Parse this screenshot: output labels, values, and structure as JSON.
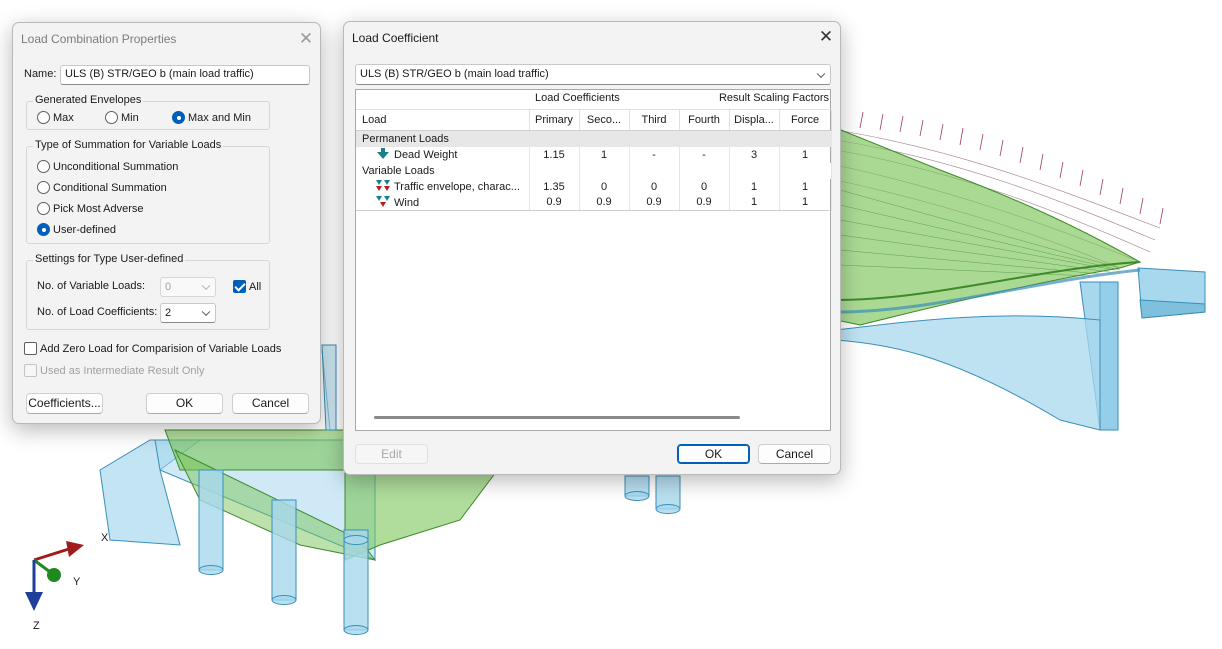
{
  "scene": {
    "axis": {
      "x": "X",
      "y": "Y",
      "z": "Z"
    },
    "colors": {
      "deck": "#7cc45a",
      "deck_edge": "#3e8a2a",
      "pier": "#a8d8ee",
      "pier_edge": "#3a8fb7",
      "axis_x": "#a01c1c",
      "axis_y": "#1f8a1f",
      "axis_z": "#1f3f9a"
    }
  },
  "lcp": {
    "title": "Load Combination Properties",
    "name_label": "Name:",
    "name_value": "ULS (B) STR/GEO b (main load traffic)",
    "envelopes": {
      "title": "Generated Envelopes",
      "options": [
        "Max",
        "Min",
        "Max and Min"
      ],
      "selected": "Max and Min"
    },
    "summation": {
      "title": "Type of Summation for Variable Loads",
      "options": [
        "Unconditional Summation",
        "Conditional Summation",
        "Pick Most Adverse",
        "User-defined"
      ],
      "selected": "User-defined"
    },
    "settings": {
      "title": "Settings for Type User-defined",
      "var_loads_label": "No. of Variable Loads:",
      "var_loads_value": "0",
      "all_label": "All",
      "all_checked": true,
      "coef_label": "No. of Load Coefficients:",
      "coef_value": "2"
    },
    "zero_load_label": "Add Zero Load for Comparision of Variable Loads",
    "intermediate_label": "Used as Intermediate Result Only",
    "buttons": {
      "coefficients": "Coefficients...",
      "ok": "OK",
      "cancel": "Cancel"
    }
  },
  "lc": {
    "title": "Load Coefficient",
    "combo_value": "ULS (B) STR/GEO b (main load traffic)",
    "caption_coefficients": "Load Coefficients",
    "caption_scaling": "Result Scaling Factors",
    "columns": [
      "Load",
      "Primary",
      "Seco...",
      "Third",
      "Fourth",
      "Displa...",
      "Force"
    ],
    "groups": [
      {
        "name": "Permanent Loads",
        "rows": [
          {
            "icon": "dead-weight-icon",
            "label": "Dead Weight",
            "values": [
              "1.15",
              "1",
              "-",
              "-",
              "3",
              "1"
            ]
          }
        ]
      },
      {
        "name": "Variable Loads",
        "rows": [
          {
            "icon": "traffic-envelope-icon",
            "label": "Traffic envelope, charac...",
            "values": [
              "1.35",
              "0",
              "0",
              "0",
              "1",
              "1"
            ]
          },
          {
            "icon": "wind-load-icon",
            "label": "Wind",
            "values": [
              "0.9",
              "0.9",
              "0.9",
              "0.9",
              "1",
              "1"
            ]
          }
        ]
      }
    ],
    "buttons": {
      "edit": "Edit",
      "ok": "OK",
      "cancel": "Cancel"
    },
    "icon_colors": {
      "down": "#1a7f8a",
      "red": "#b02020"
    }
  }
}
